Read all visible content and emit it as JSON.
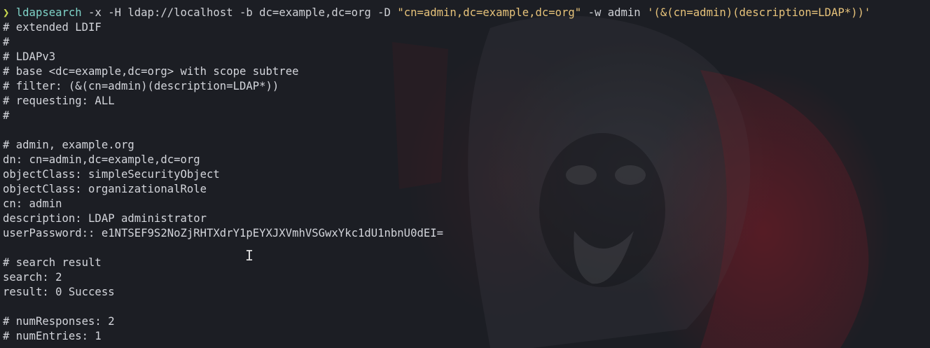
{
  "terminal": {
    "command": {
      "prompt_symbol": "❯",
      "name": "ldapsearch",
      "args": " -x -H ldap://localhost -b dc=example,dc=org -D ",
      "bind_dn": "\"cn=admin,dc=example,dc=org\"",
      "pass_args": " -w admin ",
      "filter": "'(&(cn=admin)(description=LDAP*))'"
    },
    "lines": [
      "# extended LDIF",
      "#",
      "# LDAPv3",
      "# base <dc=example,dc=org> with scope subtree",
      "# filter: (&(cn=admin)(description=LDAP*))",
      "# requesting: ALL",
      "#",
      "",
      "# admin, example.org",
      "dn: cn=admin,dc=example,dc=org",
      "objectClass: simpleSecurityObject",
      "objectClass: organizationalRole",
      "cn: admin",
      "description: LDAP administrator",
      "userPassword:: e1NTSEF9S2NoZjRHTXdrY1pEYXJXVmhVSGwxYkc1dU1nbnU0dEI=",
      "",
      "# search result",
      "search: 2",
      "result: 0 Success",
      "",
      "# numResponses: 2",
      "# numEntries: 1"
    ],
    "mouse_cursor_icon": "text-cursor-icon"
  }
}
